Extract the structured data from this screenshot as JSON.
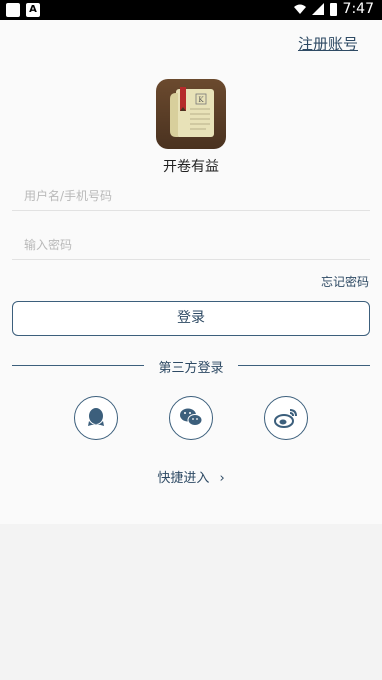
{
  "status_bar": {
    "time": "7:47"
  },
  "header": {
    "register_link": "注册账号"
  },
  "app": {
    "name": "开卷有益"
  },
  "form": {
    "username_placeholder": "用户名/手机号码",
    "password_placeholder": "输入密码",
    "forgot_password": "忘记密码",
    "login_button": "登录"
  },
  "third_party": {
    "title": "第三方登录",
    "providers": [
      "qq-icon",
      "wechat-icon",
      "weibo-icon"
    ]
  },
  "quick_entry": {
    "label": "快捷进入",
    "chevron": "›"
  },
  "colors": {
    "accent": "#2e4a64",
    "border": "#3c5f7c"
  }
}
